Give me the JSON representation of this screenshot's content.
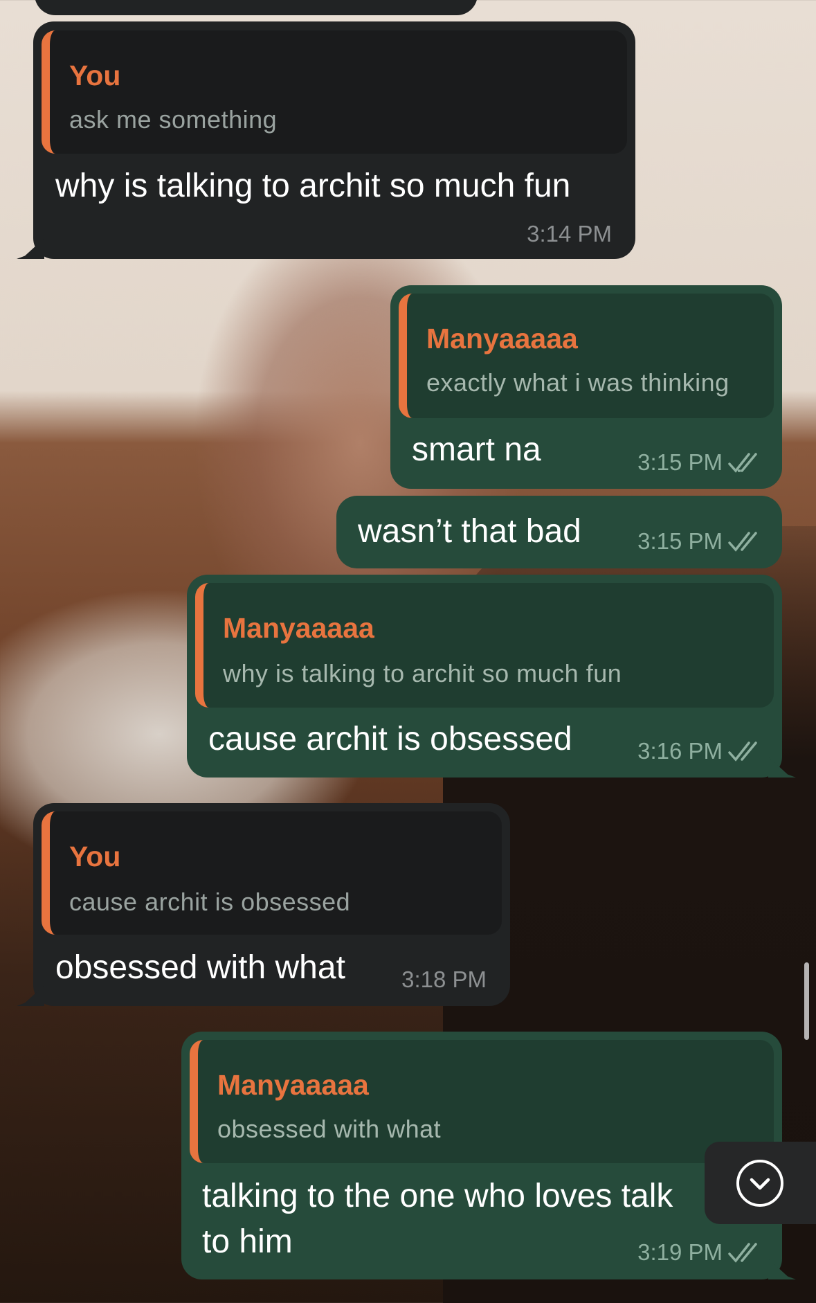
{
  "messages": [
    {
      "direction": "incoming",
      "quote_author": "You",
      "quote_text": "ask me something",
      "text": "why is talking to archit so much fun",
      "time": "3:14 PM"
    },
    {
      "direction": "outgoing",
      "quote_author": "Manyaaaaa",
      "quote_text": "exactly what i was thinking",
      "text": "smart na",
      "time": "3:15 PM",
      "status": "read"
    },
    {
      "direction": "outgoing",
      "text": "wasn’t that bad",
      "time": "3:15 PM",
      "status": "read"
    },
    {
      "direction": "outgoing",
      "quote_author": "Manyaaaaa",
      "quote_text": "why is talking to archit so much fun",
      "text": "cause archit is obsessed",
      "time": "3:16 PM",
      "status": "read"
    },
    {
      "direction": "incoming",
      "quote_author": "You",
      "quote_text": "cause archit is obsessed",
      "text": "obsessed with what",
      "time": "3:18 PM"
    },
    {
      "direction": "outgoing",
      "quote_author": "Manyaaaaa",
      "quote_text": "obsessed with what",
      "text_line1": "talking to the one who loves talk",
      "text_line2": "to him",
      "time": "3:19 PM",
      "status": "read"
    }
  ],
  "icons": {
    "read": "double-check-icon",
    "scroll_down": "chevron-down-circle-icon"
  },
  "colors": {
    "accent": "#e8743f",
    "outgoing": "#264b3b",
    "incoming": "#212324"
  }
}
